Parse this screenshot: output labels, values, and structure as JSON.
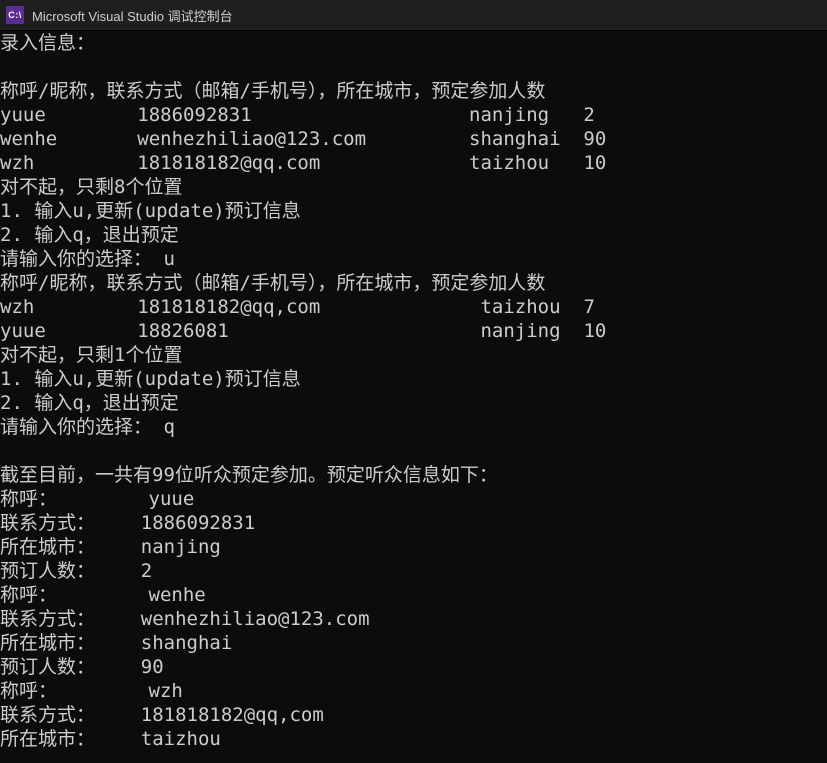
{
  "window": {
    "title": "Microsoft Visual Studio 调试控制台",
    "icon_label": "C:\\"
  },
  "console": {
    "intro": "录入信息：",
    "header": "称呼/昵称，联系方式（邮箱/手机号），所在城市，预定参加人数",
    "entries1": [
      {
        "name": "yuue",
        "contact": "1886092831",
        "city": "nanjing",
        "count": "2"
      },
      {
        "name": "wenhe",
        "contact": "wenhezhiliao@123.com",
        "city": "shanghai",
        "count": "90"
      },
      {
        "name": "wzh",
        "contact": "181818182@qq.com",
        "city": "taizhou",
        "count": "10"
      }
    ],
    "remain1": "对不起，只剩8个位置",
    "menu1": "1. 输入u,更新(update)预订信息",
    "menu2": "2. 输入q，退出预定",
    "prompt": "请输入你的选择：",
    "choice1": "u",
    "entries2": [
      {
        "name": "wzh",
        "contact": "181818182@qq,com",
        "city": "taizhou",
        "count": "7"
      },
      {
        "name": "yuue",
        "contact": "18826081",
        "city": "nanjing",
        "count": "10"
      }
    ],
    "remain2": "对不起，只剩1个位置",
    "choice2": "q",
    "summary": "截至目前，一共有99位听众预定参加。预定听众信息如下：",
    "labels": {
      "name": "称呼：",
      "contact": "联系方式：",
      "city": "所在城市：",
      "count": "预订人数："
    },
    "details": [
      {
        "name": "yuue",
        "contact": "1886092831",
        "city": "nanjing",
        "count": "2"
      },
      {
        "name": "wenhe",
        "contact": "wenhezhiliao@123.com",
        "city": "shanghai",
        "count": "90"
      },
      {
        "name": "wzh",
        "contact": "181818182@qq,com",
        "city": "taizhou"
      }
    ]
  }
}
